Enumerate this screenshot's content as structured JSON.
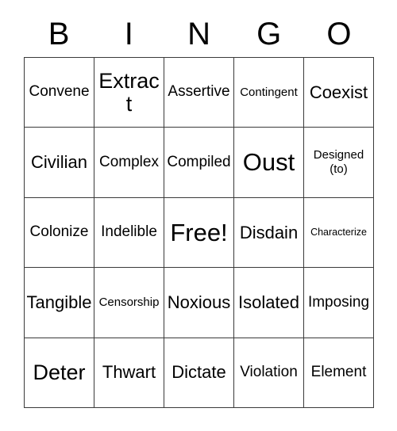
{
  "card": {
    "title": "BINGO",
    "header_letters": [
      "B",
      "I",
      "N",
      "G",
      "O"
    ],
    "columns": 5,
    "rows": 5,
    "border_color": "#3a3a3a",
    "background_color": "#ffffff",
    "text_color": "#000000",
    "free_space": "Free!",
    "grid": [
      [
        {
          "text": "Convene",
          "size": "sm"
        },
        {
          "text": "Extract",
          "size": "lg"
        },
        {
          "text": "Assertive",
          "size": "sm"
        },
        {
          "text": "Contingent",
          "size": "xs"
        },
        {
          "text": "Coexist",
          "size": "md"
        }
      ],
      [
        {
          "text": "Civilian",
          "size": "md"
        },
        {
          "text": "Complex",
          "size": "sm"
        },
        {
          "text": "Compiled",
          "size": "sm"
        },
        {
          "text": "Oust",
          "size": "xl"
        },
        {
          "text": "Designed (to)",
          "size": "two-line"
        }
      ],
      [
        {
          "text": "Colonize",
          "size": "sm"
        },
        {
          "text": "Indelible",
          "size": "sm"
        },
        {
          "text": "Free!",
          "size": "xl"
        },
        {
          "text": "Disdain",
          "size": "md"
        },
        {
          "text": "Characterize",
          "size": "xxs"
        }
      ],
      [
        {
          "text": "Tangible",
          "size": "md"
        },
        {
          "text": "Censorship",
          "size": "xs"
        },
        {
          "text": "Noxious",
          "size": "md"
        },
        {
          "text": "Isolated",
          "size": "md"
        },
        {
          "text": "Imposing",
          "size": "sm"
        }
      ],
      [
        {
          "text": "Deter",
          "size": "lg"
        },
        {
          "text": "Thwart",
          "size": "md"
        },
        {
          "text": "Dictate",
          "size": "md"
        },
        {
          "text": "Violation",
          "size": "sm"
        },
        {
          "text": "Element",
          "size": "sm"
        }
      ]
    ]
  }
}
